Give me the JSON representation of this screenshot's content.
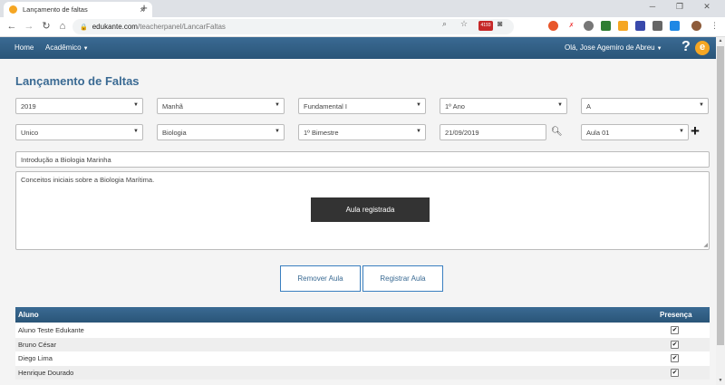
{
  "browser": {
    "tab_title": "Lançamento de faltas",
    "tab_close": "×",
    "new_tab": "+",
    "url_host": "edukante.com",
    "url_path": "/teacherpanel/LancarFaltas",
    "ext_badge": "4193"
  },
  "navbar": {
    "home": "Home",
    "academico": "Acadêmico",
    "user": "Olá, Jose Agemiro de Abreu",
    "help": "?",
    "logo": "e"
  },
  "page": {
    "title": "Lançamento de Faltas"
  },
  "filters": {
    "ano": "2019",
    "turno": "Manhã",
    "nivel": "Fundamental I",
    "serie": "1º Ano",
    "turma": "A",
    "tipo": "Unico",
    "disciplina": "Biologia",
    "bimestre": "1º Bimestre",
    "data": "21/09/2019",
    "aula": "Aula 01"
  },
  "lesson": {
    "titulo": "Introdução a Biologia Marinha",
    "descricao": "Conceitos iniciais sobre a Biologia Marítima.",
    "toast": "Aula registrada"
  },
  "actions": {
    "remover": "Remover Aula",
    "registrar": "Registrar Aula"
  },
  "table": {
    "col_aluno": "Aluno",
    "col_presenca": "Presença",
    "rows": [
      {
        "nome": "Aluno Teste Edukante",
        "presente": "✔"
      },
      {
        "nome": "Bruno César",
        "presente": "✔"
      },
      {
        "nome": "Diego Lima",
        "presente": "✔"
      },
      {
        "nome": "Henrique Dourado",
        "presente": "✔"
      }
    ]
  },
  "colors": {
    "brand": "#3a6a93",
    "accent": "#f5a623"
  }
}
